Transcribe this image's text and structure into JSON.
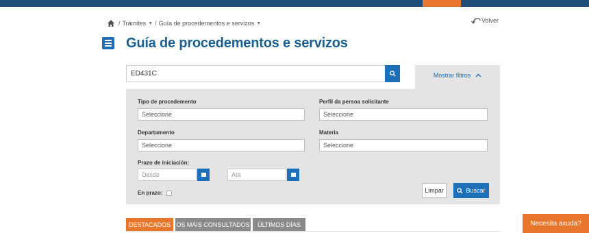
{
  "colors": {
    "brand": "#1d4f7a",
    "accent": "#e8762d",
    "primary": "#1d6fb8",
    "panel": "#e4e4e4"
  },
  "breadcrumb": {
    "home_icon": "home-icon",
    "level1": "Trámites",
    "level2": "Guía de procedementos e servizos"
  },
  "back_label": "Volver",
  "page_title": "Guía de procedementos e servizos",
  "search": {
    "value": "ED431C",
    "icon": "search-icon"
  },
  "filters_toggle": {
    "label": "Mostrar filtros",
    "icon": "chevron-up-icon"
  },
  "filters": {
    "tipo_label": "Tipo de procedemento",
    "tipo_value": "Seleccione",
    "perfil_label": "Perfil da persoa solicitante",
    "perfil_value": "Seleccione",
    "departamento_label": "Departamento",
    "departamento_value": "Seleccione",
    "materia_label": "Materia",
    "materia_value": "Seleccione",
    "prazo_label": "Prazo de iniciación:",
    "desde_placeholder": "Desde",
    "ata_placeholder": "Ata",
    "en_prazo_label": "En prazo:",
    "en_prazo_checked": false
  },
  "actions": {
    "clear_label": "Limpar",
    "search_label": "Buscar"
  },
  "tabs": [
    {
      "label": "DESTACADOS",
      "active": true
    },
    {
      "label": "OS MÁIS CONSULTADOS",
      "active": false
    },
    {
      "label": "ÚLTIMOS DÍAS",
      "active": false
    }
  ],
  "help_label": "Necesita axuda?"
}
